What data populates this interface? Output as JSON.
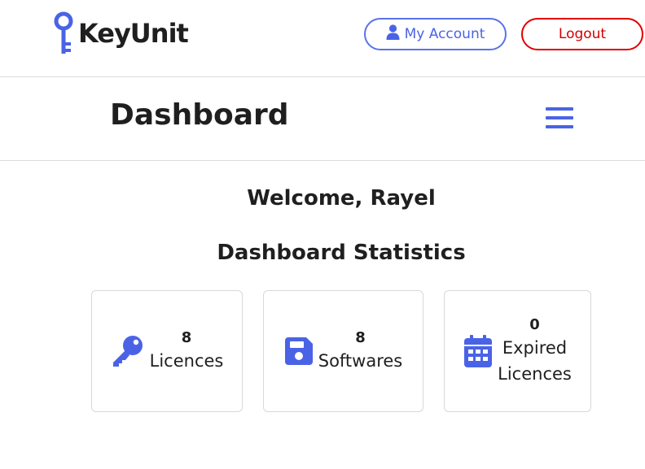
{
  "header": {
    "brand": "KeyUnit",
    "account_label": "My Account",
    "logout_label": "Logout"
  },
  "titlebar": {
    "title": "Dashboard"
  },
  "main": {
    "welcome": "Welcome, Rayel",
    "stats_title": "Dashboard Statistics",
    "cards": [
      {
        "value": "8",
        "label": "Licences",
        "icon": "key-icon"
      },
      {
        "value": "8",
        "label": "Softwares",
        "icon": "floppy-disk-icon"
      },
      {
        "value": "0",
        "label_line1": "Expired",
        "label_line2": "Licences",
        "icon": "calendar-icon"
      }
    ]
  },
  "colors": {
    "accent": "#4a63e6",
    "logout": "#d00000",
    "text": "#1f1f1f",
    "border": "#dcdcdc"
  }
}
